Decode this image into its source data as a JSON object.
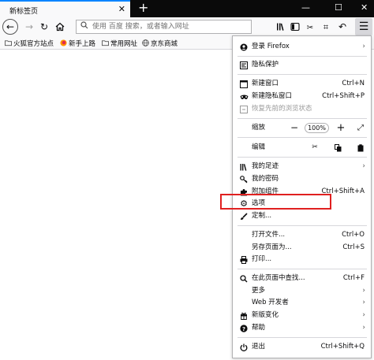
{
  "tab": {
    "title": "新标签页"
  },
  "window_controls": {
    "minimize": "—",
    "maximize": "☐",
    "close": "✕"
  },
  "navbar": {
    "search_placeholder": "使用 百度 搜索，或者输入网址"
  },
  "bookmarks": [
    {
      "label": "火狐官方站点",
      "icon": "folder-icon"
    },
    {
      "label": "新手上路",
      "icon": "firefox-icon"
    },
    {
      "label": "常用网址",
      "icon": "folder-icon"
    },
    {
      "label": "京东商城",
      "icon": "globe-icon"
    }
  ],
  "menu": {
    "signin": "登录 Firefox",
    "privacy": "隐私保护",
    "new_window": {
      "label": "新建窗口",
      "shortcut": "Ctrl+N"
    },
    "new_private": {
      "label": "新建隐私窗口",
      "shortcut": "Ctrl+Shift+P"
    },
    "restore": "恢复先前的浏览状态",
    "zoom": {
      "label": "缩放",
      "value": "100%"
    },
    "edit": {
      "label": "编辑"
    },
    "library": "我的足迹",
    "logins": "我的密码",
    "addons": {
      "label": "附加组件",
      "shortcut": "Ctrl+Shift+A"
    },
    "options": "选项",
    "customize": "定制...",
    "open_file": {
      "label": "打开文件...",
      "shortcut": "Ctrl+O"
    },
    "save_page": {
      "label": "另存页面为...",
      "shortcut": "Ctrl+S"
    },
    "print": "打印...",
    "find": {
      "label": "在此页面中查找...",
      "shortcut": "Ctrl+F"
    },
    "more": "更多",
    "webdev": "Web 开发者",
    "whatsnew": "新版变化",
    "help": "帮助",
    "quit": {
      "label": "退出",
      "shortcut": "Ctrl+Shift+Q"
    }
  },
  "colors": {
    "accent": "#0a84ff",
    "highlight_box": "#e02020",
    "tabstrip": "#0a0a0a"
  }
}
